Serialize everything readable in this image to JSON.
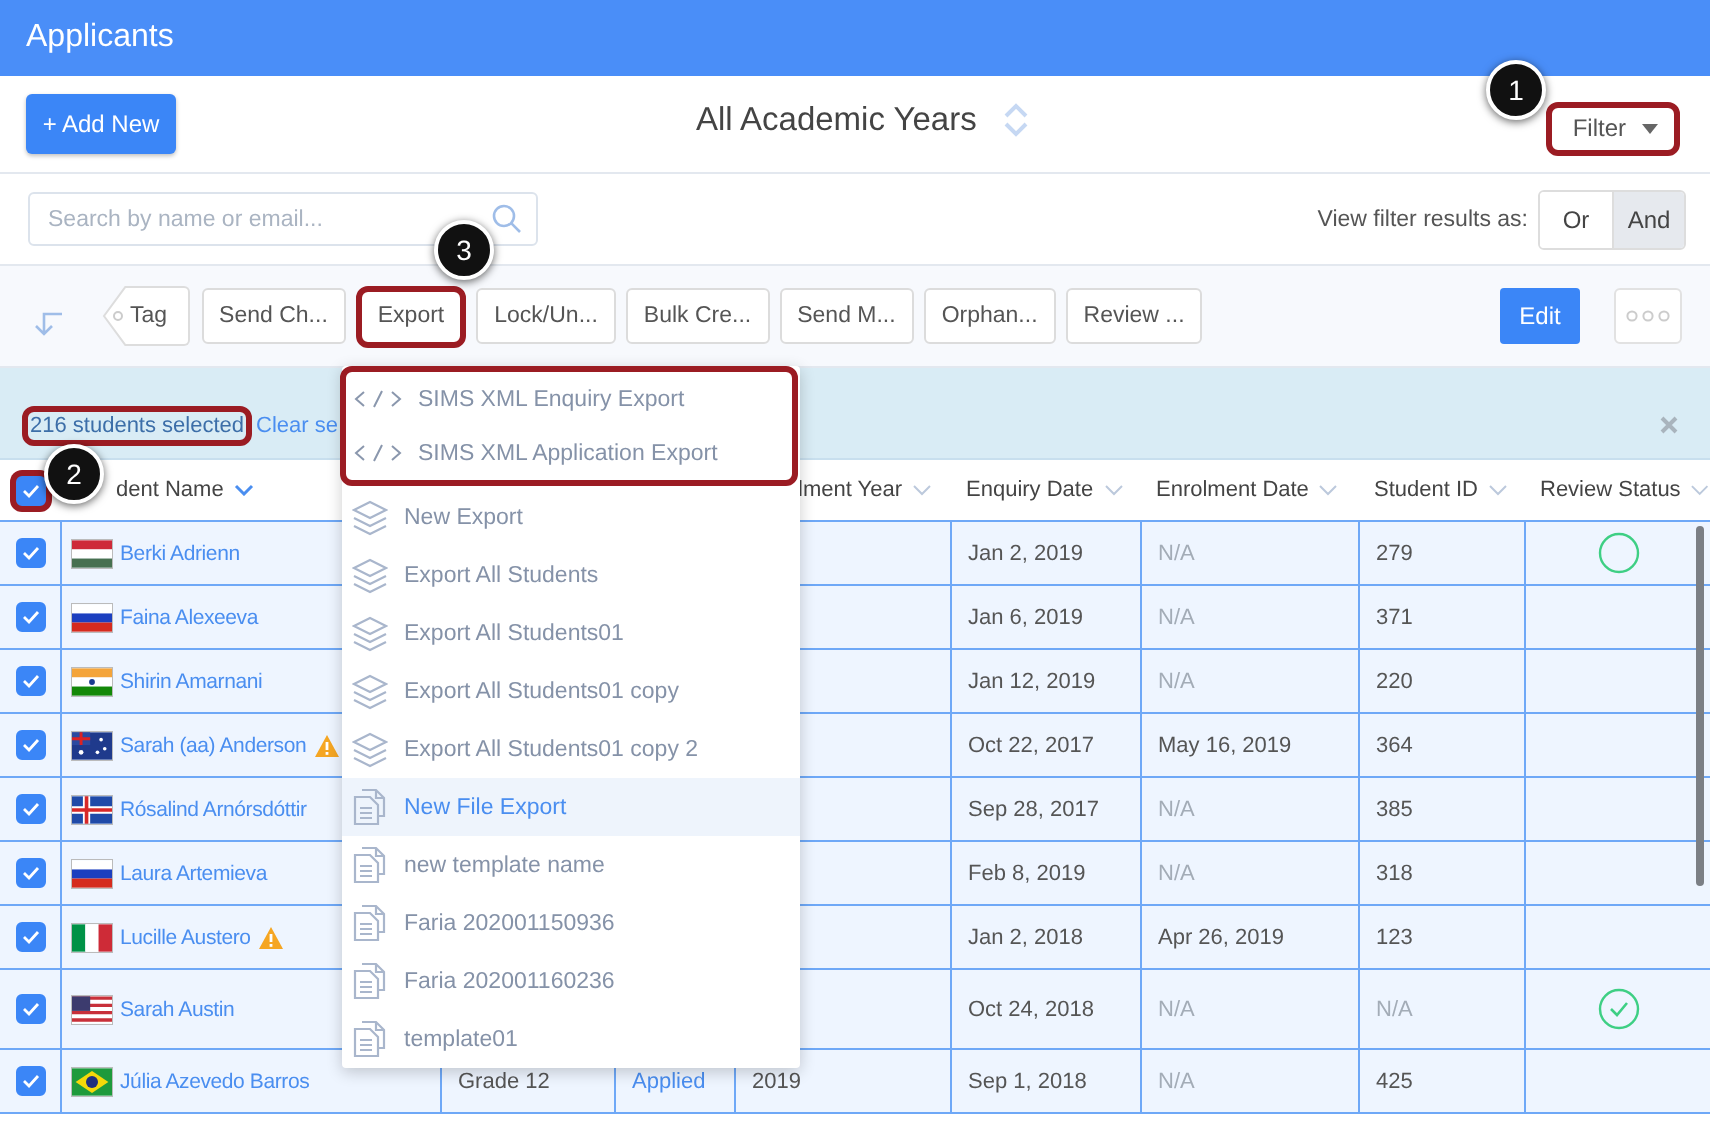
{
  "title": "Applicants",
  "add_button": "+ Add New",
  "year_selector": "All Academic Years",
  "filter_button": {
    "label": "Filter",
    "highlighted": true
  },
  "search": {
    "placeholder": "Search by name or email..."
  },
  "filter_mode": {
    "label": "View filter results as:",
    "options": [
      {
        "label": "Or",
        "selected": false
      },
      {
        "label": "And",
        "selected": true
      }
    ]
  },
  "toolbar": {
    "tag": "Tag",
    "actions": [
      {
        "label": "Send Ch...",
        "highlighted": false
      },
      {
        "label": "Export",
        "highlighted": true
      },
      {
        "label": "Lock/Un...",
        "highlighted": false
      },
      {
        "label": "Bulk Cre...",
        "highlighted": false
      },
      {
        "label": "Send M...",
        "highlighted": false
      },
      {
        "label": "Orphan...",
        "highlighted": false
      },
      {
        "label": "Review ...",
        "highlighted": false
      }
    ],
    "edit": "Edit"
  },
  "selection": {
    "count": "216 students selected",
    "highlighted": true,
    "clear": "Clear se"
  },
  "header": {
    "select_all": {
      "checked": true,
      "highlighted": true
    },
    "columns": [
      {
        "label": "dent Name",
        "sorted": true
      },
      {
        "label": "lment Year",
        "sorted": false
      },
      {
        "label": "Enquiry Date",
        "sorted": false
      },
      {
        "label": "Enrolment Date",
        "sorted": false
      },
      {
        "label": "Student ID",
        "sorted": false
      },
      {
        "label": "Review Status",
        "sorted": false
      }
    ]
  },
  "rows": [
    {
      "checked": true,
      "flag": {
        "kind": "hu"
      },
      "name": "Berki Adrienn",
      "warning": false,
      "enquiry": "Jan 2, 2019",
      "enrolment": {
        "text": "N/A",
        "muted": true
      },
      "student_id": {
        "text": "279",
        "muted": false
      },
      "review": {
        "kind": "pending"
      }
    },
    {
      "checked": true,
      "flag": {
        "kind": "ru"
      },
      "name": "Faina Alexeeva",
      "warning": false,
      "enquiry": "Jan 6, 2019",
      "enrolment": {
        "text": "N/A",
        "muted": true
      },
      "student_id": {
        "text": "371",
        "muted": false
      }
    },
    {
      "checked": true,
      "flag": {
        "kind": "in"
      },
      "name": "Shirin Amarnani",
      "warning": false,
      "enquiry": "Jan 12, 2019",
      "enrolment": {
        "text": "N/A",
        "muted": true
      },
      "student_id": {
        "text": "220",
        "muted": false
      }
    },
    {
      "checked": true,
      "flag": {
        "kind": "au"
      },
      "name": "Sarah (aa) Anderson",
      "warning": true,
      "enquiry": "Oct 22, 2017",
      "enrolment": {
        "text": "May 16, 2019",
        "muted": false
      },
      "student_id": {
        "text": "364",
        "muted": false
      }
    },
    {
      "checked": true,
      "flag": {
        "kind": "is"
      },
      "name": "Rósalind Arnórsdóttir",
      "warning": false,
      "enquiry": "Sep 28, 2017",
      "enrolment": {
        "text": "N/A",
        "muted": true
      },
      "student_id": {
        "text": "385",
        "muted": false
      }
    },
    {
      "checked": true,
      "flag": {
        "kind": "ru"
      },
      "name": "Laura Artemieva",
      "warning": false,
      "enquiry": "Feb 8, 2019",
      "enrolment": {
        "text": "N/A",
        "muted": true
      },
      "student_id": {
        "text": "318",
        "muted": false
      }
    },
    {
      "checked": true,
      "flag": {
        "kind": "it"
      },
      "name": "Lucille Austero",
      "warning": true,
      "enquiry": "Jan 2, 2018",
      "enrolment": {
        "text": "Apr 26, 2019",
        "muted": false
      },
      "student_id": {
        "text": "123",
        "muted": false
      }
    },
    {
      "checked": true,
      "flag": {
        "kind": "us"
      },
      "name": "Sarah Austin",
      "warning": false,
      "tall": true,
      "enquiry": "Oct 24, 2018",
      "enrolment": {
        "text": "N/A",
        "muted": true
      },
      "student_id": {
        "text": "N/A",
        "muted": true
      },
      "review": {
        "kind": "approved"
      }
    },
    {
      "checked": true,
      "flag": {
        "kind": "br"
      },
      "name": "Júlia Azevedo Barros",
      "warning": false,
      "grade": "Grade 12",
      "status": "Applied",
      "year": "2019",
      "enquiry": "Sep 1, 2018",
      "enrolment": {
        "text": "N/A",
        "muted": true
      },
      "student_id": {
        "text": "425",
        "muted": false
      }
    }
  ],
  "export_menu": {
    "groups": [
      {
        "highlighted": true,
        "items": [
          {
            "kind": "xml",
            "label": "SIMS XML Enquiry Export",
            "hovered": false
          },
          {
            "kind": "xml",
            "label": "SIMS XML Application Export",
            "hovered": false
          }
        ]
      },
      {
        "highlighted": false,
        "items": [
          {
            "kind": "layers",
            "label": "New Export",
            "hovered": false
          },
          {
            "kind": "layers",
            "label": "Export All Students",
            "hovered": false
          },
          {
            "kind": "layers",
            "label": "Export All Students01",
            "hovered": false
          },
          {
            "kind": "layers",
            "label": "Export All Students01 copy",
            "hovered": false
          },
          {
            "kind": "layers",
            "label": "Export All Students01 copy 2",
            "hovered": false
          },
          {
            "kind": "file",
            "label": "New File Export",
            "hovered": true
          },
          {
            "kind": "file",
            "label": "new template name",
            "hovered": false
          },
          {
            "kind": "file",
            "label": "Faria 202001150936",
            "hovered": false
          },
          {
            "kind": "file",
            "label": "Faria 202001160236",
            "hovered": false
          },
          {
            "kind": "file",
            "label": "template01",
            "hovered": false
          }
        ]
      }
    ]
  },
  "callouts": [
    {
      "number": "1"
    },
    {
      "number": "2"
    },
    {
      "number": "3"
    }
  ]
}
